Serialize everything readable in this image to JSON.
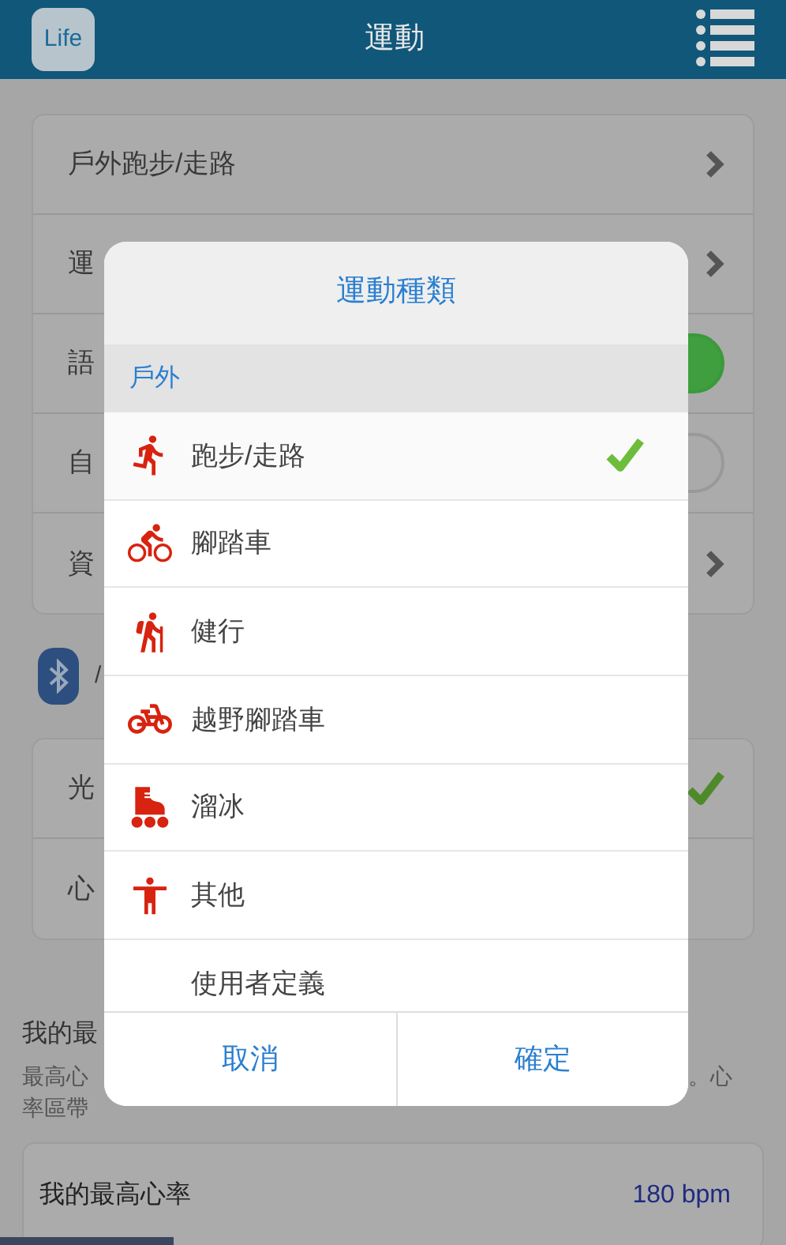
{
  "header": {
    "logo": "Life",
    "title": "運動"
  },
  "settings_card": [
    {
      "label": "戶外跑步/走路",
      "kind": "chevron"
    },
    {
      "label": "運",
      "kind": "chevron"
    },
    {
      "label": "語",
      "kind": "toggle",
      "on": true
    },
    {
      "label": "自",
      "kind": "toggle",
      "on": false
    },
    {
      "label": "資",
      "kind": "chevron"
    }
  ],
  "bluetooth_label": "/",
  "sensor_card": [
    {
      "label": "光",
      "kind": "check",
      "checked": true
    },
    {
      "label": "心",
      "kind": "check",
      "checked": false
    }
  ],
  "max_hr_section": {
    "heading": "我的最",
    "description_left": [
      "最高心",
      "率區帶"
    ],
    "description_right": "。心"
  },
  "max_hr_card": {
    "label": "我的最高心率",
    "value": "180 bpm"
  },
  "dialog": {
    "title": "運動種類",
    "section": "戶外",
    "items": [
      {
        "label": "跑步/走路",
        "kind": "run",
        "selected": true
      },
      {
        "label": "腳踏車",
        "kind": "bike",
        "selected": false
      },
      {
        "label": "健行",
        "kind": "hike",
        "selected": false
      },
      {
        "label": "越野腳踏車",
        "kind": "mtb",
        "selected": false
      },
      {
        "label": "溜冰",
        "kind": "skate",
        "selected": false
      },
      {
        "label": "其他",
        "kind": "other",
        "selected": false
      },
      {
        "label": "使用者定義",
        "kind": "none",
        "selected": false
      }
    ],
    "buttons": [
      "取消",
      "確定"
    ]
  }
}
